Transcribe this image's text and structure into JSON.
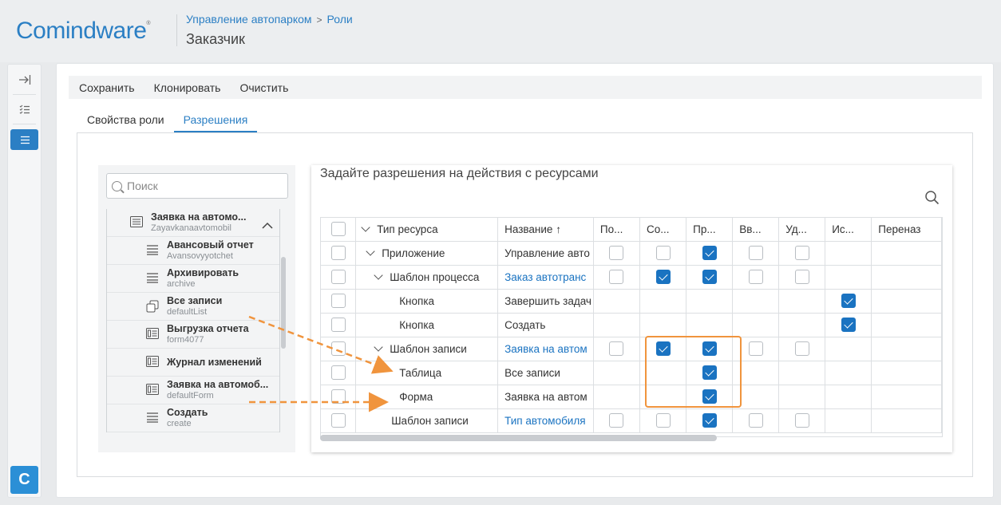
{
  "header": {
    "logo": "Comindware",
    "logo_mark": "®",
    "breadcrumb": [
      "Управление автопарком",
      "Роли"
    ],
    "breadcrumb_sep": ">",
    "title": "Заказчик"
  },
  "toolbar": {
    "save": "Сохранить",
    "clone": "Клонировать",
    "clear": "Очистить"
  },
  "tabs": [
    {
      "label": "Свойства роли",
      "active": false
    },
    {
      "label": "Разрешения",
      "active": true
    }
  ],
  "tree": {
    "search_placeholder": "Поиск",
    "items": [
      {
        "name": "Заявка на автомо...",
        "sys": "Zayavkanaavtomobil",
        "icon": "form-icon"
      },
      {
        "name": "Авансовый отчет",
        "sys": "Avansovyyotchet",
        "icon": "list-icon"
      },
      {
        "name": "Архивировать",
        "sys": "archive",
        "icon": "list-icon"
      },
      {
        "name": "Все записи",
        "sys": "defaultList",
        "icon": "copy-icon"
      },
      {
        "name": "Выгрузка отчета",
        "sys": "form4077",
        "icon": "report-icon"
      },
      {
        "name": "Журнал изменений",
        "sys": "",
        "icon": "report-icon"
      },
      {
        "name": "Заявка на автомоб...",
        "sys": "defaultForm",
        "icon": "report-icon"
      },
      {
        "name": "Создать",
        "sys": "create",
        "icon": "list-icon"
      }
    ]
  },
  "permissions": {
    "title": "Задайте разрешения на действия с ресурсами",
    "columns": [
      "Тип ресурса",
      "Название",
      "По...",
      "Со...",
      "Пр...",
      "Вв...",
      "Уд...",
      "Ис...",
      "Переназ"
    ],
    "sort_indicator": "↑",
    "rows": [
      {
        "type": "Приложение",
        "name": "Управление авто",
        "link": false,
        "cb": [
          0,
          0,
          1,
          0,
          0,
          null
        ]
      },
      {
        "type": "Шаблон процесса",
        "name": "Заказ автотранс",
        "link": true,
        "cb": [
          0,
          1,
          1,
          0,
          0,
          null
        ]
      },
      {
        "type": "Кнопка",
        "name": "Завершить задач",
        "link": false,
        "cb": [
          null,
          null,
          null,
          null,
          null,
          1
        ]
      },
      {
        "type": "Кнопка",
        "name": "Создать",
        "link": false,
        "cb": [
          null,
          null,
          null,
          null,
          null,
          1
        ]
      },
      {
        "type": "Шаблон записи",
        "name": "Заявка на автом",
        "link": true,
        "cb": [
          0,
          1,
          1,
          0,
          0,
          null
        ]
      },
      {
        "type": "Таблица",
        "name": "Все записи",
        "link": false,
        "cb": [
          null,
          null,
          1,
          null,
          null,
          null
        ]
      },
      {
        "type": "Форма",
        "name": "Заявка на автом",
        "link": false,
        "cb": [
          null,
          null,
          1,
          null,
          null,
          null
        ]
      },
      {
        "type": "Шаблон записи",
        "name": "Тип автомобиля",
        "link": true,
        "cb": [
          0,
          0,
          1,
          0,
          0,
          null
        ]
      }
    ]
  },
  "rail": {
    "badge": "C"
  },
  "colors": {
    "accent": "#2b7fc4",
    "checkbox": "#1a73c1",
    "annotation": "#f0943d"
  }
}
